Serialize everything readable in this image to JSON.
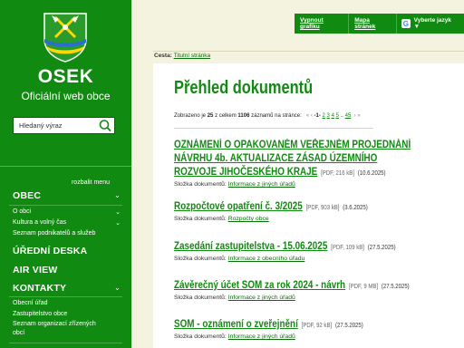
{
  "brand": {
    "title": "OSEK",
    "subtitle": "Oficiální web obce",
    "search_placeholder": "Hledaný výraz"
  },
  "topbar": {
    "disable_graphics": "Vypnout grafiku",
    "sitemap": "Mapa stránek",
    "language": "Vyberte jazyk ▼"
  },
  "breadcrumb": {
    "label": "Cesta:",
    "home": "Titulní stránka"
  },
  "sidebar": {
    "expand_menu": "rozbalit menu",
    "sections": {
      "obec": "OBEC",
      "uredni_deska": "ÚŘEDNÍ DESKA",
      "air_view": "AIR VIEW",
      "kontakty": "KONTAKTY"
    },
    "obec_items": [
      "O obci",
      "Kultura a volný čas",
      "Seznam podnikatelů a služeb"
    ],
    "kontakty_items": [
      "Obecní úřad",
      "Zastupitelstvo obce",
      "Seznam organizací zřízených",
      "obcí"
    ]
  },
  "page": {
    "title": "Přehled dokumentů",
    "pager_text": "Zobrazeno je",
    "pager_shown": "25",
    "pager_mid": "z celkem",
    "pager_total": "1106",
    "pager_tail": "záznamů na stránce:",
    "pages": [
      "-1-",
      "2",
      "3",
      "4",
      "5",
      "..",
      "45"
    ]
  },
  "documents": [
    {
      "title": "OZNÁMENÍ O OPAKOVANÉM VEŘEJNÉM PROJEDNÁNÍ NÁVRHU 4b. AKTUALIZACE ZÁSAD ÚZEMNÍHO ROZVOJE JIHOČESKÉHO KRAJE",
      "meta": "[PDF, 216 kB]",
      "date": "(10.6.2025)",
      "folder_label": "Složka dokumentů:",
      "folder": "Informace z jiných úřadů"
    },
    {
      "title": "Rozpočtové opatření č. 3/2025",
      "meta": "[PDF, 903 kB]",
      "date": "(3.6.2025)",
      "folder_label": "Složka dokumentů:",
      "folder": "Rozpočty obce"
    },
    {
      "title": "Zasedání zastupitelstva - 15.06.2025",
      "meta": "[PDF, 109 kB]",
      "date": "(27.5.2025)",
      "folder_label": "Složka dokumentů:",
      "folder": "Informace z obecního úřadu"
    },
    {
      "title": "Závěrečný účet SOM za rok 2024 - návrh",
      "meta": "[PDF, 9 MB]",
      "date": "(27.5.2025)",
      "folder_label": "Složka dokumentů:",
      "folder": "Informace z jiných úřadů"
    },
    {
      "title": "SOM - oznámení o zveřejnění",
      "meta": "[PDF, 92 kB]",
      "date": "(27.5.2025)",
      "folder_label": "Složka dokumentů:",
      "folder": "Informace z jiných úřadů"
    }
  ],
  "colors": {
    "brand_green": "#118a11",
    "page_bg": "#f4f3e0",
    "content_bg": "#ffffff"
  }
}
